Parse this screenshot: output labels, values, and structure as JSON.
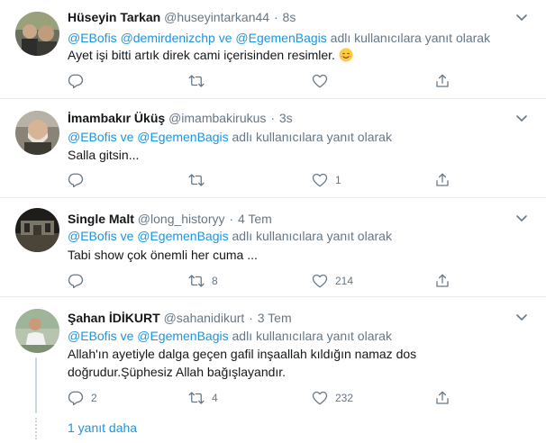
{
  "tweets": [
    {
      "name": "Hüseyin Tarkan",
      "handle": "@huseyintarkan44",
      "dot": "·",
      "time": "8s",
      "mentions": "@EBofis @demirdenizchp ve @EgemenBagis",
      "reply_suffix": " adlı kullanıcılara yanıt olarak",
      "text": "Ayet işi bitti artık direk cami içerisinden resimler.",
      "emoji": "smiling-face-emoji",
      "reply_count": "",
      "retweet_count": "",
      "like_count": ""
    },
    {
      "name": "İmambakır Üküş",
      "handle": "@imambakirukus",
      "dot": "·",
      "time": "3s",
      "mentions": "@EBofis ve @EgemenBagis",
      "reply_suffix": " adlı kullanıcılara yanıt olarak",
      "text": "Salla gitsin...",
      "reply_count": "",
      "retweet_count": "",
      "like_count": "1"
    },
    {
      "name": "Single Malt",
      "handle": "@long_historyy",
      "dot": "·",
      "time": "4 Tem",
      "mentions": "@EBofis ve @EgemenBagis",
      "reply_suffix": " adlı kullanıcılara yanıt olarak",
      "text": "Tabi show çok önemli her cuma ...",
      "reply_count": "",
      "retweet_count": "8",
      "like_count": "214"
    },
    {
      "name": "Şahan İDİKURT",
      "handle": "@sahanidikurt",
      "dot": "·",
      "time": "3 Tem",
      "mentions": "@EBofis ve @EgemenBagis",
      "reply_suffix": " adlı kullanıcılara yanıt olarak",
      "text_line1": "Allah'ın ayetiyle dalga geçen gafil inşaallah kıldığın namaz dos",
      "text_line2": "doğrudur.Şüphesiz Allah bağışlayandır.",
      "reply_count": "2",
      "retweet_count": "4",
      "like_count": "232"
    }
  ],
  "more_replies": "1 yanıt daha",
  "colors": {
    "link": "#1b95e0",
    "muted": "#657786",
    "divider": "#e6ecf0"
  }
}
